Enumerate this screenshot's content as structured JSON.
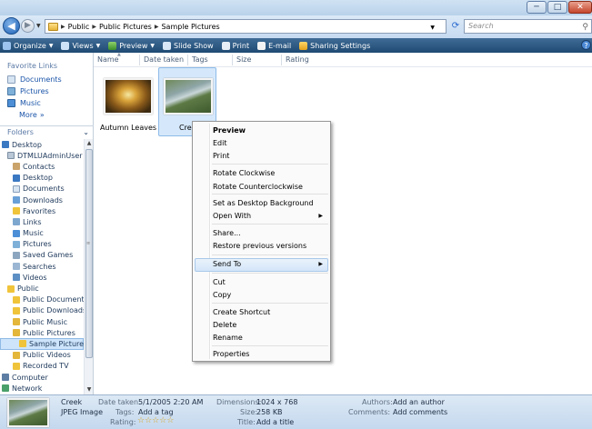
{
  "window": {
    "minimize_icon": "minimize-icon",
    "maximize_icon": "maximize-icon",
    "close_icon": "close-icon"
  },
  "address": {
    "crumbs": [
      "Public",
      "Public Pictures",
      "Sample Pictures"
    ],
    "search_placeholder": "Search"
  },
  "toolbar": {
    "organize": "Organize",
    "views": "Views",
    "preview": "Preview",
    "slideshow": "Slide Show",
    "print": "Print",
    "email": "E-mail",
    "sharing": "Sharing Settings"
  },
  "nav": {
    "favorites_header": "Favorite Links",
    "favorites": [
      "Documents",
      "Pictures",
      "Music"
    ],
    "more": "More",
    "folders_header": "Folders",
    "tree": [
      "Desktop",
      "DTMLUAdminUser",
      "Contacts",
      "Desktop",
      "Documents",
      "Downloads",
      "Favorites",
      "Links",
      "Music",
      "Pictures",
      "Saved Games",
      "Searches",
      "Videos",
      "Public",
      "Public Documents",
      "Public Downloads",
      "Public Music",
      "Public Pictures",
      "Sample Pictures",
      "Public Videos",
      "Recorded TV",
      "Computer",
      "Network"
    ]
  },
  "columns": [
    "Name",
    "Date taken",
    "Tags",
    "Size",
    "Rating"
  ],
  "files": [
    {
      "label": "Autumn Leaves"
    },
    {
      "label": "Cree"
    }
  ],
  "context_menu": {
    "preview": "Preview",
    "edit": "Edit",
    "print": "Print",
    "rotate_cw": "Rotate Clockwise",
    "rotate_ccw": "Rotate Counterclockwise",
    "set_background": "Set as Desktop Background",
    "open_with": "Open With",
    "share": "Share...",
    "restore": "Restore previous versions",
    "send_to": "Send To",
    "cut": "Cut",
    "copy": "Copy",
    "create_shortcut": "Create Shortcut",
    "delete": "Delete",
    "rename": "Rename",
    "properties": "Properties"
  },
  "details": {
    "name": "Creek",
    "type": "JPEG Image",
    "date_label": "Date taken:",
    "date_value": "5/1/2005 2:20 AM",
    "tags_label": "Tags:",
    "tags_value": "Add a tag",
    "rating_label": "Rating:",
    "rating_value": 0,
    "dimensions_label": "Dimensions:",
    "dimensions_value": "1024 x 768",
    "size_label": "Size:",
    "size_value": "258 KB",
    "title_label": "Title:",
    "title_value": "Add a title",
    "authors_label": "Authors:",
    "authors_value": "Add an author",
    "comments_label": "Comments:",
    "comments_value": "Add comments"
  },
  "colors": {
    "toolbar": "#2c5a86",
    "selection": "#d5e8fb",
    "link": "#1a54a8"
  }
}
